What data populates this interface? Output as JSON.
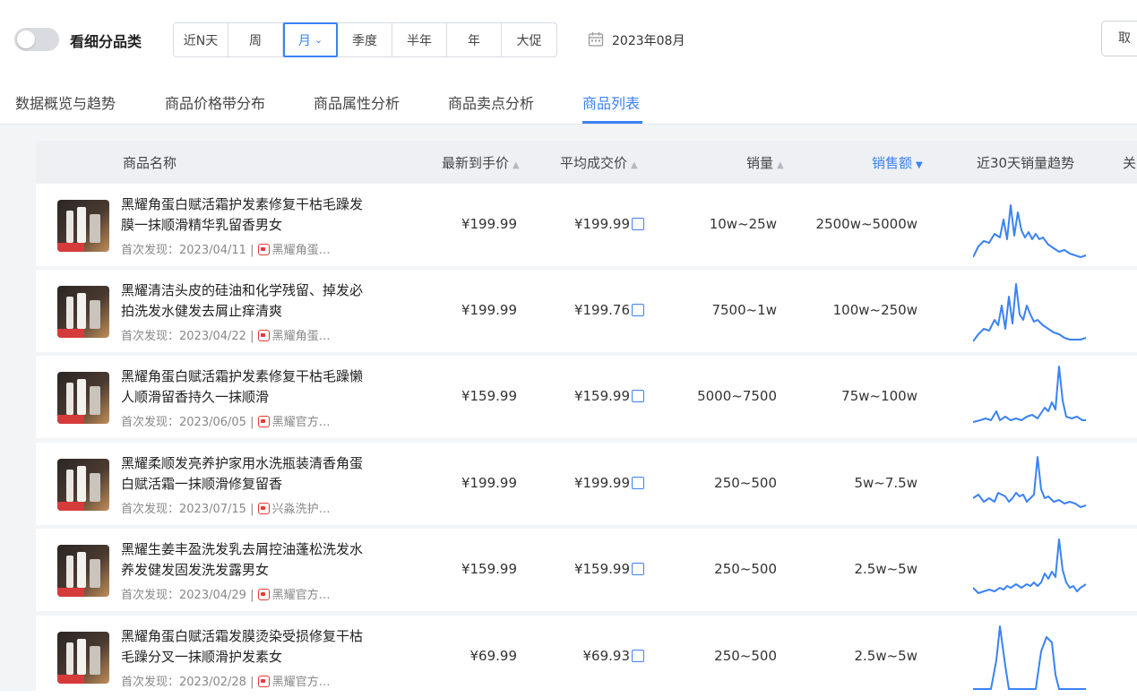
{
  "toggle": {
    "label": "看细分品类",
    "on": false
  },
  "period_segments": [
    {
      "label": "近N天"
    },
    {
      "label": "周"
    },
    {
      "label": "月",
      "active": true
    },
    {
      "label": "季度"
    },
    {
      "label": "半年"
    },
    {
      "label": "年"
    },
    {
      "label": "大促"
    }
  ],
  "date_value": "2023年08月",
  "cancel_label": "取",
  "tabs": [
    {
      "label": "数据概览与趋势"
    },
    {
      "label": "商品价格带分布"
    },
    {
      "label": "商品属性分析"
    },
    {
      "label": "商品卖点分析"
    },
    {
      "label": "商品列表",
      "active": true
    }
  ],
  "table": {
    "headers": {
      "name": "商品名称",
      "latest_price": "最新到手价",
      "avg_price": "平均成交价",
      "sales_volume": "销量",
      "sales_amount": "销售额",
      "trend": "近30天销量趋势",
      "more": "关"
    },
    "sorted_column": "sales_amount",
    "accent_color": "#3b82f6",
    "first_seen_prefix": "首次发现：",
    "rows": [
      {
        "title": "黑耀角蛋白赋活霜护发素修复干枯毛躁发膜一抹顺滑精华乳留香男女",
        "first_seen": "2023/04/11",
        "shop": "黑耀角蛋…",
        "latest_price": "¥199.99",
        "avg_price": "¥199.99",
        "sales_volume": "10w~25w",
        "sales_amount": "2500w~5000w"
      },
      {
        "title": "黑耀清洁头皮的硅油和化学残留、掉发必拍洗发水健发去屑止痒清爽",
        "first_seen": "2023/04/22",
        "shop": "黑耀角蛋…",
        "latest_price": "¥199.99",
        "avg_price": "¥199.76",
        "sales_volume": "7500~1w",
        "sales_amount": "100w~250w"
      },
      {
        "title": "黑耀角蛋白赋活霜护发素修复干枯毛躁懒人顺滑留香持久一抹顺滑",
        "first_seen": "2023/06/05",
        "shop": "黑耀官方…",
        "latest_price": "¥159.99",
        "avg_price": "¥159.99",
        "sales_volume": "5000~7500",
        "sales_amount": "75w~100w"
      },
      {
        "title": "黑耀柔顺发亮养护家用水洗瓶装清香角蛋白赋活霜一抹顺滑修复留香",
        "first_seen": "2023/07/15",
        "shop": "兴淼洗护…",
        "latest_price": "¥199.99",
        "avg_price": "¥199.99",
        "sales_volume": "250~500",
        "sales_amount": "5w~7.5w"
      },
      {
        "title": "黑耀生姜丰盈洗发乳去屑控油蓬松洗发水养发健发固发洗发露男女",
        "first_seen": "2023/04/29",
        "shop": "黑耀官方…",
        "latest_price": "¥159.99",
        "avg_price": "¥159.99",
        "sales_volume": "250~500",
        "sales_amount": "2.5w~5w"
      },
      {
        "title": "黑耀角蛋白赋活霜发膜烫染受损修复干枯毛躁分叉一抹顺滑护发素女",
        "first_seen": "2023/02/28",
        "shop": "黑耀官方…",
        "latest_price": "¥69.99",
        "avg_price": "¥69.93",
        "sales_volume": "250~500",
        "sales_amount": "2.5w~5w"
      }
    ]
  }
}
